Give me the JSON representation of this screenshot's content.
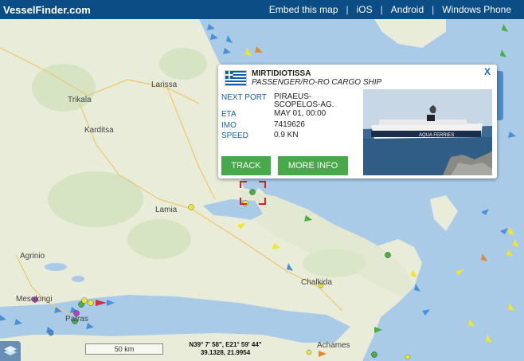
{
  "header": {
    "brand": "VesselFinder.com",
    "links": [
      "Embed this map",
      "iOS",
      "Android",
      "Windows Phone"
    ],
    "separator": "|"
  },
  "cities": [
    "Larissa",
    "Trikala",
    "Karditsa",
    "Lamia",
    "Agrinio",
    "Chalkida",
    "Mesolongi",
    "Patras",
    "Achames"
  ],
  "popup": {
    "close": "X",
    "vessel_name": "MIRTIDIOTISSA",
    "vessel_type": "PASSENGER/RO-RO CARGO SHIP",
    "next_port_label": "NEXT PORT",
    "next_port_value": "PIRAEUS-SCOPELOS-AG.",
    "eta_label": "ETA",
    "eta_value": "MAY 01, 00:00",
    "imo_label": "IMO",
    "imo_value": "7419626",
    "speed_label": "SPEED",
    "speed_value": "0.9 KN",
    "track_button": "TRACK",
    "more_info_button": "MORE INFO",
    "photo_hull_text": "AQUA FERRIES",
    "flag_icon": "greece-flag-icon"
  },
  "map": {
    "scale_label": "50 km",
    "coords_dms": "N39° 7' 58\", E21° 59' 44\"",
    "coords_decimal": "39.1328, 21.9954"
  },
  "colors": {
    "header": "#0d4d86",
    "sea": "#a9cbe8",
    "land": "#e8ecd9",
    "button": "#49a84a",
    "label": "#1a5f9e"
  }
}
